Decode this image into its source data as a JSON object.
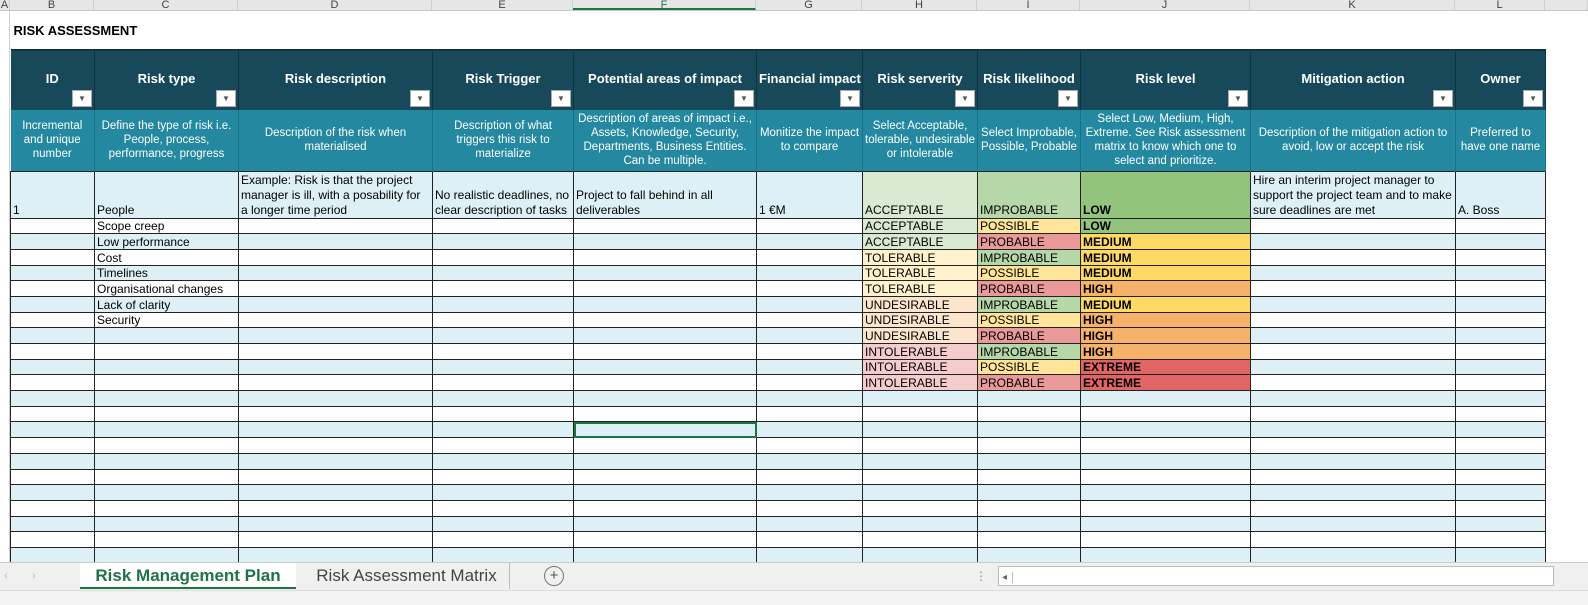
{
  "columns": [
    "A",
    "B",
    "C",
    "D",
    "E",
    "F",
    "G",
    "H",
    "I",
    "J",
    "K",
    "L"
  ],
  "title": "RISK ASSESSMENT",
  "headers": [
    "ID",
    "Risk type",
    "Risk description",
    "Risk Trigger",
    "Potential areas of impact",
    "Financial impact",
    "Risk serverity",
    "Risk likelihood",
    "Risk level",
    "Mitigation action",
    "Owner"
  ],
  "descriptions": [
    "Incremental and unique number",
    "Define the type of risk i.e. People, process, performance, progress",
    "Description of the risk when materialised",
    "Description of what triggers this risk to materialize",
    "Description of areas of impact i.e., Assets, Knowledge, Security, Departments, Business Entities. Can be multiple.",
    "Monitize the impact to compare",
    "Select Acceptable, tolerable, undesirable or intolerable",
    "Select Improbable, Possible, Probable",
    "Select Low, Medium, High, Extreme. See Risk assessment matrix to know which one to select and prioritize.",
    "Description of the mitigation action to avoid, low or accept the risk",
    "Preferred to have one name"
  ],
  "first_row": [
    "1",
    "People",
    "Example: Risk is that the project manager is ill, with a posability for a longer time period",
    "No realistic deadlines, no clear description of tasks",
    "Project to fall behind in all deliverables",
    "1 €M",
    "ACCEPTABLE",
    "IMPROBABLE",
    "LOW",
    "Hire an interim project manager to support the project team and to make sure deadlines are met",
    "A. Boss"
  ],
  "risk_types": [
    "Scope creep",
    "Low performance",
    "Cost",
    "Timelines",
    "Organisational changes",
    "Lack of clarity",
    "Security"
  ],
  "matrix": [
    [
      "ACCEPTABLE",
      "POSSIBLE",
      "LOW"
    ],
    [
      "ACCEPTABLE",
      "PROBABLE",
      "MEDIUM"
    ],
    [
      "TOLERABLE",
      "IMPROBABLE",
      "MEDIUM"
    ],
    [
      "TOLERABLE",
      "POSSIBLE",
      "MEDIUM"
    ],
    [
      "TOLERABLE",
      "PROBABLE",
      "HIGH"
    ],
    [
      "UNDESIRABLE",
      "IMPROBABLE",
      "MEDIUM"
    ],
    [
      "UNDESIRABLE",
      "POSSIBLE",
      "HIGH"
    ],
    [
      "UNDESIRABLE",
      "PROBABLE",
      "HIGH"
    ],
    [
      "INTOLERABLE",
      "IMPROBABLE",
      "HIGH"
    ],
    [
      "INTOLERABLE",
      "POSSIBLE",
      "EXTREME"
    ],
    [
      "INTOLERABLE",
      "PROBABLE",
      "EXTREME"
    ]
  ],
  "colors": {
    "ACCEPTABLE": "#d9ead3",
    "TOLERABLE": "#fff2cc",
    "UNDESIRABLE": "#fce5cd",
    "INTOLERABLE": "#f4cccc",
    "IMPROBABLE": "#b6d7a8",
    "POSSIBLE": "#ffe599",
    "PROBABLE": "#ea9999",
    "LOW": "#93c47d",
    "MEDIUM": "#ffd966",
    "HIGH": "#f6b26b",
    "EXTREME": "#e06666"
  },
  "tabs": {
    "active": "Risk Management Plan",
    "other": "Risk Assessment Matrix",
    "add": "+"
  }
}
